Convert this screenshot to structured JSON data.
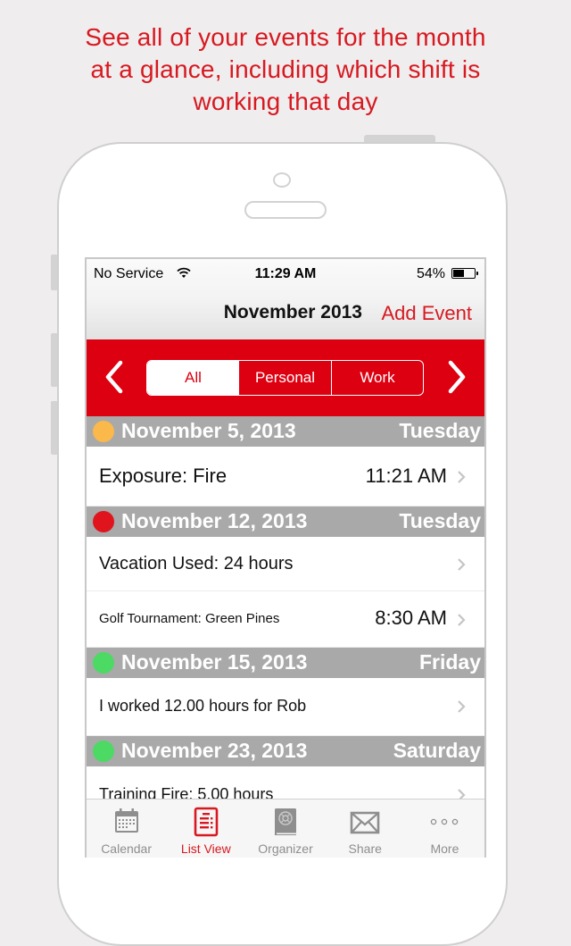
{
  "headline": {
    "line1": "See all of your events for the month",
    "line2": "at a glance, including which shift is",
    "line3": "working that day"
  },
  "status_bar": {
    "carrier": "No Service",
    "wifi_icon": "wifi-icon",
    "time": "11:29 AM",
    "battery_percent": "54%",
    "battery_level": 0.54
  },
  "nav": {
    "title": "November 2013",
    "add_event": "Add Event"
  },
  "filter": {
    "prev_icon": "chevron-left-icon",
    "next_icon": "chevron-right-icon",
    "segments": [
      {
        "label": "All",
        "selected": true
      },
      {
        "label": "Personal",
        "selected": false
      },
      {
        "label": "Work",
        "selected": false
      }
    ]
  },
  "sections": [
    {
      "date": "November 5, 2013",
      "weekday": "Tuesday",
      "shift_color": "#fbb84b",
      "events": [
        {
          "title": "Exposure: Fire",
          "time": "11:21 AM"
        }
      ]
    },
    {
      "date": "November 12, 2013",
      "weekday": "Tuesday",
      "shift_color": "#e0141d",
      "events": [
        {
          "title": "Vacation Used: 24 hours",
          "time": ""
        },
        {
          "title": "Golf Tournament: Green Pines",
          "time": "8:30 AM"
        }
      ]
    },
    {
      "date": "November 15, 2013",
      "weekday": "Friday",
      "shift_color": "#4cd964",
      "events": [
        {
          "title": "I worked 12.00 hours for Rob",
          "time": ""
        }
      ]
    },
    {
      "date": "November 23, 2013",
      "weekday": "Saturday",
      "shift_color": "#4cd964",
      "events": [
        {
          "title": "Training Fire: 5.00 hours",
          "time": ""
        }
      ]
    }
  ],
  "tabbar": [
    {
      "label": "Calendar",
      "icon": "calendar-icon",
      "active": false
    },
    {
      "label": "List View",
      "icon": "list-view-icon",
      "active": true
    },
    {
      "label": "Organizer",
      "icon": "organizer-book-icon",
      "active": false
    },
    {
      "label": "Share",
      "icon": "envelope-icon",
      "active": false
    },
    {
      "label": "More",
      "icon": "more-dots-icon",
      "active": false
    }
  ],
  "colors": {
    "accent_red": "#d71920",
    "filter_bar_red": "#dd0011",
    "section_gray": "#a9a9a9",
    "tab_inactive": "#8e8e8e"
  }
}
